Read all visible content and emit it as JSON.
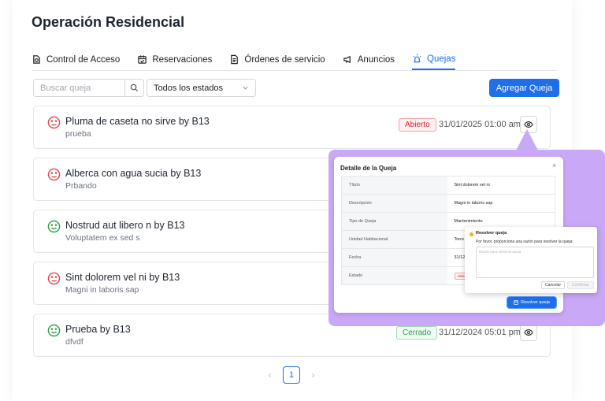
{
  "title": "Operación Residencial",
  "tabs": [
    {
      "label": "Control de Acceso",
      "icon": "access-control-icon"
    },
    {
      "label": "Reservaciones",
      "icon": "calendar-check-icon"
    },
    {
      "label": "Órdenes de servicio",
      "icon": "document-icon"
    },
    {
      "label": "Anuncios",
      "icon": "megaphone-icon"
    },
    {
      "label": "Quejas",
      "icon": "siren-icon",
      "active": true
    }
  ],
  "filters": {
    "search_placeholder": "Buscar queja",
    "status_select": "Todos los estados",
    "add_button": "Agregar Queja"
  },
  "complaints": [
    {
      "title": "Pluma de caseta no sirve by B13",
      "description": "prueba",
      "status": "Abierto",
      "date": "31/01/2025 01:00 am",
      "mood": "sad"
    },
    {
      "title": "Alberca con agua sucia by B13",
      "description": "Prbando",
      "status": "",
      "date": "",
      "mood": "sad"
    },
    {
      "title": "Nostrud aut libero n by B13",
      "description": "Voluptatem ex sed s",
      "status": "",
      "date": "",
      "mood": "happy"
    },
    {
      "title": "Sint dolorem vel ni by B13",
      "description": "Magni in laboris sap",
      "status": "",
      "date": "",
      "mood": "sad"
    },
    {
      "title": "Prueba by B13",
      "description": "dfvdf",
      "status": "Cerrado",
      "date": "31/12/2024 05:01 pm",
      "mood": "happy"
    }
  ],
  "pagination": {
    "current_page": "1",
    "prev": "‹",
    "next": "›"
  },
  "detail_modal": {
    "title": "Detalle de la Queja",
    "close": "×",
    "rows": [
      {
        "label": "Título",
        "value": "Sint dolorem vel ni"
      },
      {
        "label": "Descripción",
        "value": "Magni in laboris sap"
      },
      {
        "label": "Tipo de Queja",
        "value": "Mantenimiento"
      },
      {
        "label": "Unidad Habitacional",
        "value": "Torre"
      },
      {
        "label": "Fecha",
        "value": "31/12"
      },
      {
        "label": "Estado",
        "value": "Abierto"
      }
    ],
    "resolve_button": "Resolver queja"
  },
  "resolve_popover": {
    "title": "Resolver queja",
    "message": "Por favor, proporciona una razón para resolver la queja:",
    "placeholder": "Razón para cerrar la queja",
    "cancel": "Cancelar",
    "confirm": "Confirmar"
  },
  "colors": {
    "accent": "#1f6feb",
    "open": "#d1242f",
    "closed": "#2ea043",
    "overlay": "#c9a8f7"
  }
}
